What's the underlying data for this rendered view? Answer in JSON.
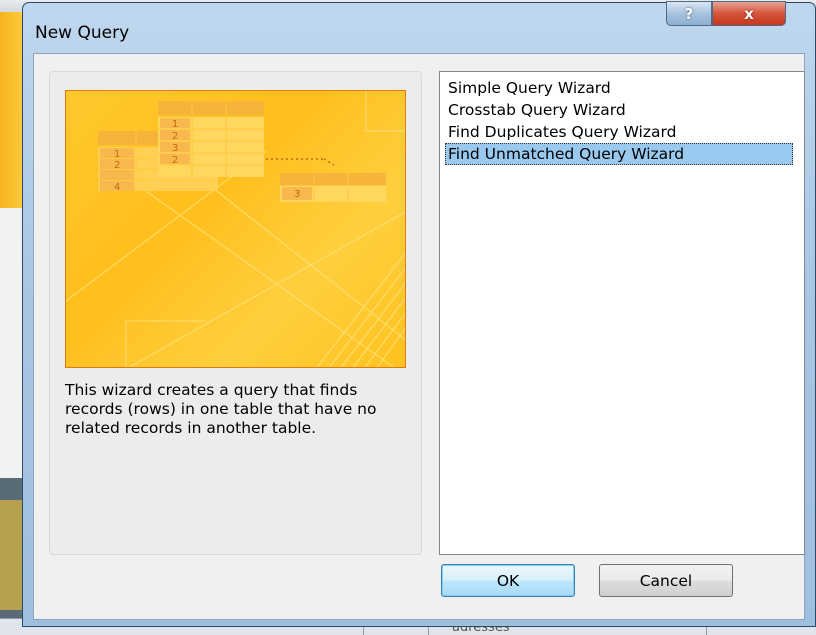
{
  "dialog": {
    "title": "New Query",
    "help_label": "?",
    "close_label": "x"
  },
  "preview": {
    "numbers": [
      "1",
      "2",
      "3",
      "2",
      "1",
      "2",
      "4",
      "3"
    ]
  },
  "description": "This wizard creates a query that finds records (rows) in one table that have no related records in another table.",
  "wizards": [
    {
      "label": "Simple Query Wizard",
      "selected": false
    },
    {
      "label": "Crosstab Query Wizard",
      "selected": false
    },
    {
      "label": "Find Duplicates Query Wizard",
      "selected": false
    },
    {
      "label": "Find Unmatched Query Wizard",
      "selected": true
    }
  ],
  "buttons": {
    "ok": "OK",
    "cancel": "Cancel"
  },
  "background": {
    "bottom_text": "adresses"
  },
  "colors": {
    "accent": "#99c9ef",
    "preview": "#ffc82c"
  }
}
